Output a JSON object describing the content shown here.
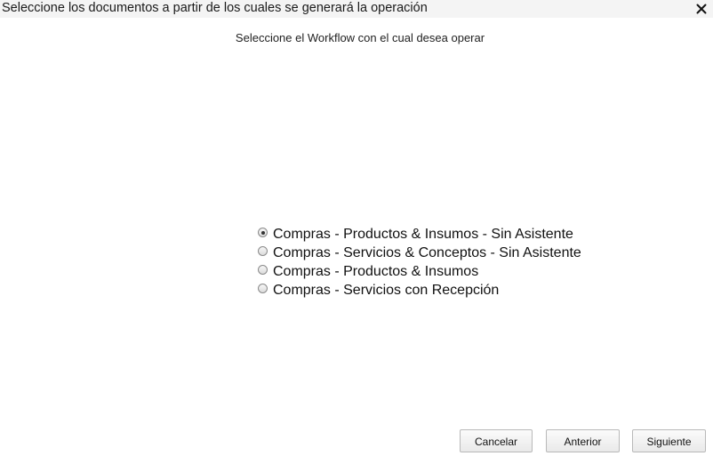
{
  "dialog": {
    "title": "Seleccione los documentos a partir de los cuales se generará la operación",
    "close_icon": "close-icon"
  },
  "main": {
    "prompt": "Seleccione el Workflow con el cual desea operar",
    "selected_index": 0,
    "options": [
      {
        "label": "Compras - Productos & Insumos - Sin Asistente",
        "checked": true
      },
      {
        "label": "Compras - Servicios & Conceptos - Sin Asistente",
        "checked": false
      },
      {
        "label": "Compras - Productos & Insumos",
        "checked": false
      },
      {
        "label": "Compras - Servicios con Recepción",
        "checked": false
      }
    ]
  },
  "footer": {
    "cancel_label": "Cancelar",
    "previous_label": "Anterior",
    "next_label": "Siguiente"
  }
}
